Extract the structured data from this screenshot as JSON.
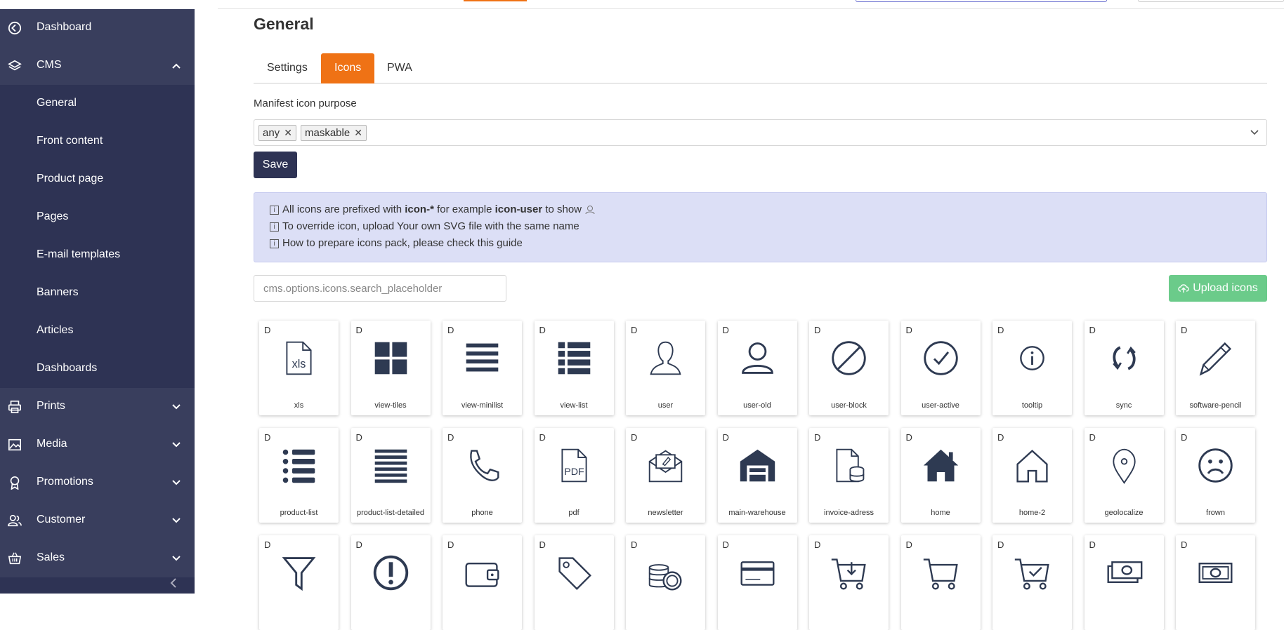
{
  "sidebar": {
    "items": [
      {
        "label": "Dashboard",
        "icon": "dashboard-icon"
      },
      {
        "label": "CMS",
        "icon": "layers-icon",
        "expanded": true
      },
      {
        "label": "General"
      },
      {
        "label": "Front content"
      },
      {
        "label": "Product page"
      },
      {
        "label": "Pages"
      },
      {
        "label": "E-mail templates"
      },
      {
        "label": "Banners"
      },
      {
        "label": "Articles"
      },
      {
        "label": "Dashboards"
      },
      {
        "label": "Prints",
        "icon": "printer-icon"
      },
      {
        "label": "Media",
        "icon": "image-icon"
      },
      {
        "label": "Promotions",
        "icon": "badge-icon"
      },
      {
        "label": "Customer",
        "icon": "users-icon"
      },
      {
        "label": "Sales",
        "icon": "basket-icon"
      }
    ]
  },
  "page": {
    "title": "General",
    "tabs": [
      {
        "label": "Settings",
        "active": false
      },
      {
        "label": "Icons",
        "active": true
      },
      {
        "label": "PWA",
        "active": false
      }
    ],
    "field_label": "Manifest icon purpose",
    "chips": [
      "any",
      "maskable"
    ],
    "save_label": "Save",
    "info": {
      "l1_a": "All icons are prefixed with ",
      "l1_b": "icon-*",
      "l1_c": " for example ",
      "l1_d": "icon-user",
      "l1_e": " to show",
      "l2": "To override icon, upload Your own SVG file with the same name",
      "l3": "How to prepare icons pack, please check this guide"
    },
    "search_placeholder": "cms.options.icons.search_placeholder",
    "upload_label": "Upload icons"
  },
  "icons": [
    {
      "d": "D",
      "name": "xls"
    },
    {
      "d": "D",
      "name": "view-tiles"
    },
    {
      "d": "D",
      "name": "view-minilist"
    },
    {
      "d": "D",
      "name": "view-list"
    },
    {
      "d": "D",
      "name": "user"
    },
    {
      "d": "D",
      "name": "user-old"
    },
    {
      "d": "D",
      "name": "user-block"
    },
    {
      "d": "D",
      "name": "user-active"
    },
    {
      "d": "D",
      "name": "tooltip"
    },
    {
      "d": "D",
      "name": "sync"
    },
    {
      "d": "D",
      "name": "software-pencil"
    },
    {
      "d": "D",
      "name": "product-list"
    },
    {
      "d": "D",
      "name": "product-list-detailed"
    },
    {
      "d": "D",
      "name": "phone"
    },
    {
      "d": "D",
      "name": "pdf"
    },
    {
      "d": "D",
      "name": "newsletter"
    },
    {
      "d": "D",
      "name": "main-warehouse"
    },
    {
      "d": "D",
      "name": "invoice-adress"
    },
    {
      "d": "D",
      "name": "home"
    },
    {
      "d": "D",
      "name": "home-2"
    },
    {
      "d": "D",
      "name": "geolocalize"
    },
    {
      "d": "D",
      "name": "frown"
    },
    {
      "d": "D",
      "name": ""
    },
    {
      "d": "D",
      "name": ""
    },
    {
      "d": "D",
      "name": ""
    },
    {
      "d": "D",
      "name": ""
    },
    {
      "d": "D",
      "name": ""
    },
    {
      "d": "D",
      "name": ""
    },
    {
      "d": "D",
      "name": ""
    },
    {
      "d": "D",
      "name": ""
    },
    {
      "d": "D",
      "name": ""
    },
    {
      "d": "D",
      "name": ""
    },
    {
      "d": "D",
      "name": ""
    }
  ],
  "colors": {
    "sidebar": "#2e3354",
    "accent": "#ef7215",
    "upload": "#6bcb8a",
    "info_bg": "#dcdff6"
  }
}
